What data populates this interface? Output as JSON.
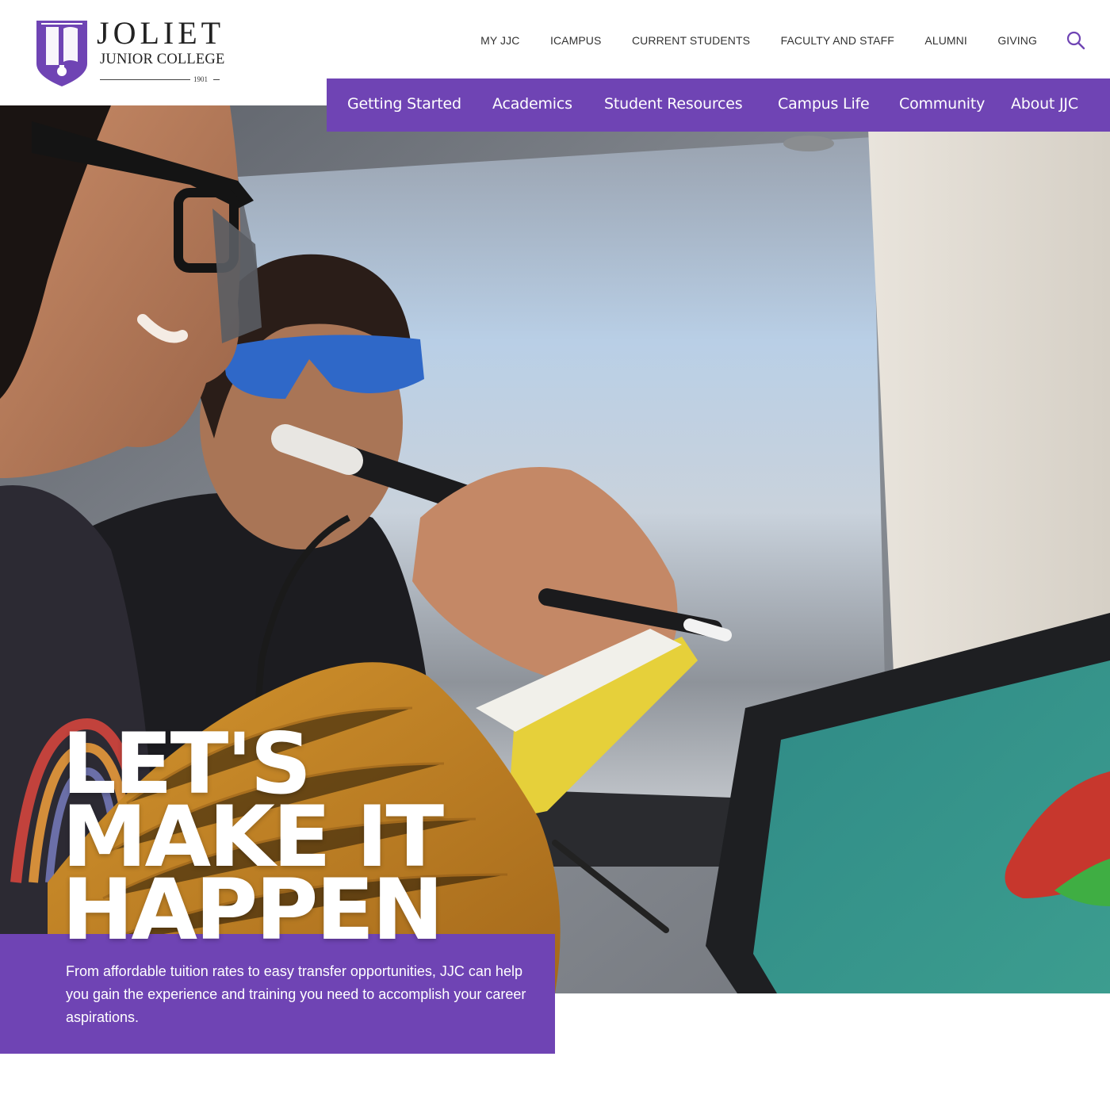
{
  "brand": {
    "name_line1": "JOLIET",
    "name_line2": "JUNIOR COLLEGE",
    "year": "1901",
    "accent_color": "#6f44b4"
  },
  "utility_nav": {
    "items": [
      {
        "label": "MY JJC"
      },
      {
        "label": "ICAMPUS"
      },
      {
        "label": "CURRENT STUDENTS"
      },
      {
        "label": "FACULTY AND STAFF"
      },
      {
        "label": "ALUMNI"
      },
      {
        "label": "GIVING"
      }
    ],
    "search_icon": "search-icon"
  },
  "main_nav": {
    "items": [
      {
        "label": "Getting Started"
      },
      {
        "label": "Academics"
      },
      {
        "label": "Student Resources"
      },
      {
        "label": "Campus Life"
      },
      {
        "label": "Community"
      },
      {
        "label": "About JJC"
      }
    ]
  },
  "hero": {
    "headline_line1": "LET'S",
    "headline_line2": "MAKE IT",
    "headline_line3": "HAPPEN",
    "body": "From affordable tuition rates to easy transfer opportunities, JJC can help you gain the experience and training you need to accomplish your career aspirations."
  }
}
